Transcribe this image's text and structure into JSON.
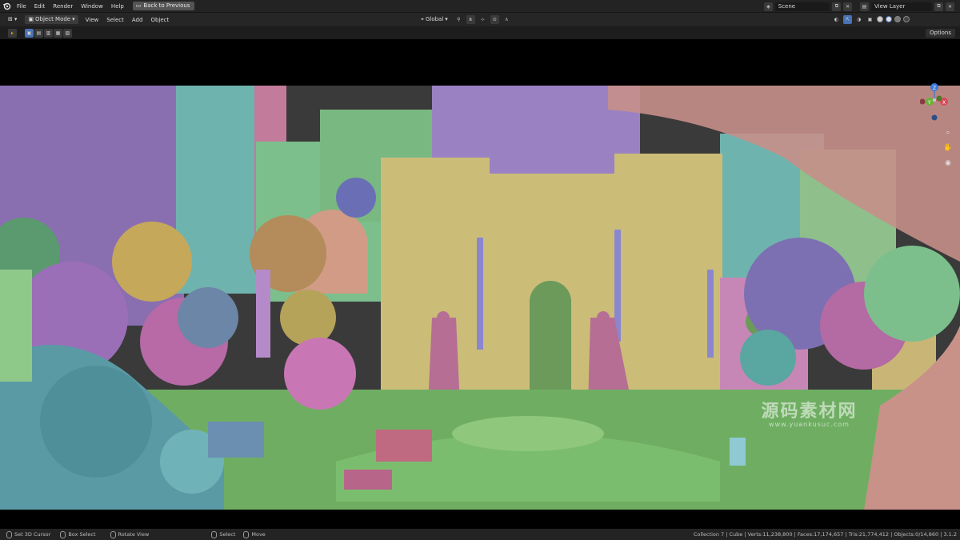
{
  "topbar": {
    "menus": [
      "File",
      "Edit",
      "Render",
      "Window",
      "Help"
    ],
    "back_button": "Back to Previous",
    "scene": "Scene",
    "view_layer": "View Layer"
  },
  "viewport_header": {
    "mode": "Object Mode",
    "menus": [
      "View",
      "Select",
      "Add",
      "Object"
    ],
    "orientation": "Global"
  },
  "toolrow": {
    "options": "Options"
  },
  "watermark": {
    "title": "源码素材网",
    "url": "www.yuankusuc.com"
  },
  "gizmo": {
    "axes": [
      "Y",
      "X",
      "Z"
    ]
  },
  "statusbar": {
    "items": [
      "Set 3D Cursor",
      "Box Select",
      "Rotate View",
      "Select",
      "Move"
    ],
    "stats": "Collection 7 | Cube | Verts:11,238,800 | Faces:17,174,657 | Tris:21,774,412 | Objects:0/14,860 | 3.1.2"
  },
  "colors": {
    "bar_bg": "#232323",
    "header_bg": "#262626",
    "accent_blue": "#4772b3"
  }
}
